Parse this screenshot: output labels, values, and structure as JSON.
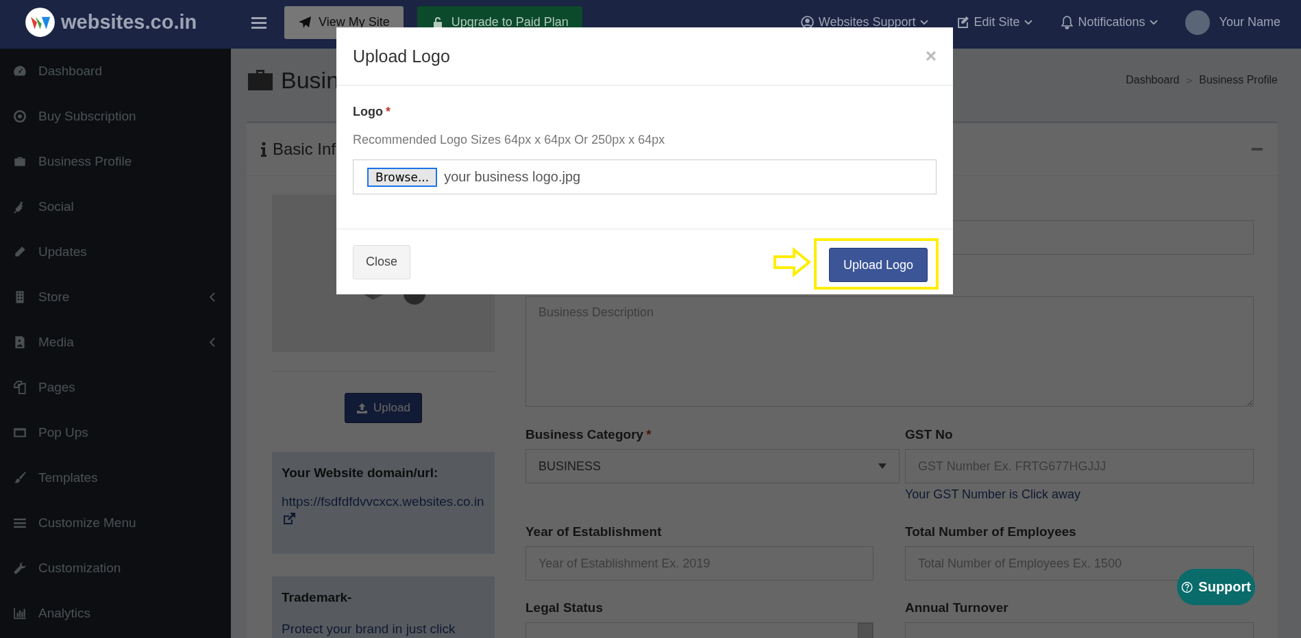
{
  "topbar": {
    "brand": "websites.co.in",
    "buttons": [
      {
        "label": "View My Site",
        "kind": "plain"
      },
      {
        "label": "Upgrade to Paid Plan",
        "kind": "success"
      }
    ],
    "menus": [
      {
        "label": "Websites Support"
      },
      {
        "label": "Edit Site"
      },
      {
        "label": "Notifications"
      }
    ],
    "user": "Your Name"
  },
  "sidebar": {
    "items": [
      {
        "label": "Dashboard",
        "has_submenu": false
      },
      {
        "label": "Buy Subscription",
        "has_submenu": false
      },
      {
        "label": "Business Profile",
        "has_submenu": false
      },
      {
        "label": "Social",
        "has_submenu": false
      },
      {
        "label": "Updates",
        "has_submenu": false
      },
      {
        "label": "Store",
        "has_submenu": true
      },
      {
        "label": "Media",
        "has_submenu": true
      },
      {
        "label": "Pages",
        "has_submenu": false
      },
      {
        "label": "Pop Ups",
        "has_submenu": false
      },
      {
        "label": "Templates",
        "has_submenu": false
      },
      {
        "label": "Customize Menu",
        "has_submenu": false
      },
      {
        "label": "Customization",
        "has_submenu": false
      },
      {
        "label": "Analytics",
        "has_submenu": false
      }
    ]
  },
  "page": {
    "title": "Busin",
    "breadcrumb": [
      "Dashboard",
      "Business Profile"
    ],
    "breadcrumb_separator": ">"
  },
  "required_mark": "*",
  "panel": {
    "title": "Basic Inf",
    "upload_button": "Upload",
    "domain": {
      "heading": "Your Website domain/url:",
      "url": "https://fsdfdfdvvcxcx.websites.co.in"
    },
    "trademark": {
      "heading": "Trademark-",
      "text": "Protect your brand in just click"
    },
    "description": {
      "placeholder": "Business Description"
    },
    "fields": [
      {
        "label": "Business Category",
        "required": true,
        "kind": "select",
        "value": "BUSINESS"
      },
      {
        "label": "GST No",
        "required": false,
        "kind": "text",
        "placeholder": "GST Number Ex. FRTG677HGJJJ",
        "hint": "Your GST Number is Click away"
      },
      {
        "label": "Year of Establishment",
        "required": false,
        "kind": "text",
        "placeholder": "Year of Establishment Ex. 2019"
      },
      {
        "label": "Total Number of Employees",
        "required": false,
        "kind": "text",
        "placeholder": "Total Number of Employees Ex. 1500"
      },
      {
        "label": "Legal Status",
        "required": false,
        "kind": "listbox"
      },
      {
        "label": "Annual Turnover",
        "required": false,
        "kind": "text"
      }
    ]
  },
  "modal": {
    "title": "Upload Logo",
    "close": "×",
    "label": "Logo",
    "required": true,
    "help": "Recommended Logo Sizes 64px x 64px Or 250px x 64px",
    "browse": "Browse...",
    "file": "your business logo.jpg",
    "buttons": [
      {
        "label": "Close",
        "kind": "default",
        "highlighted": false
      },
      {
        "label": "Upload Logo",
        "kind": "primary",
        "highlighted": true
      }
    ]
  },
  "support": "Support"
}
